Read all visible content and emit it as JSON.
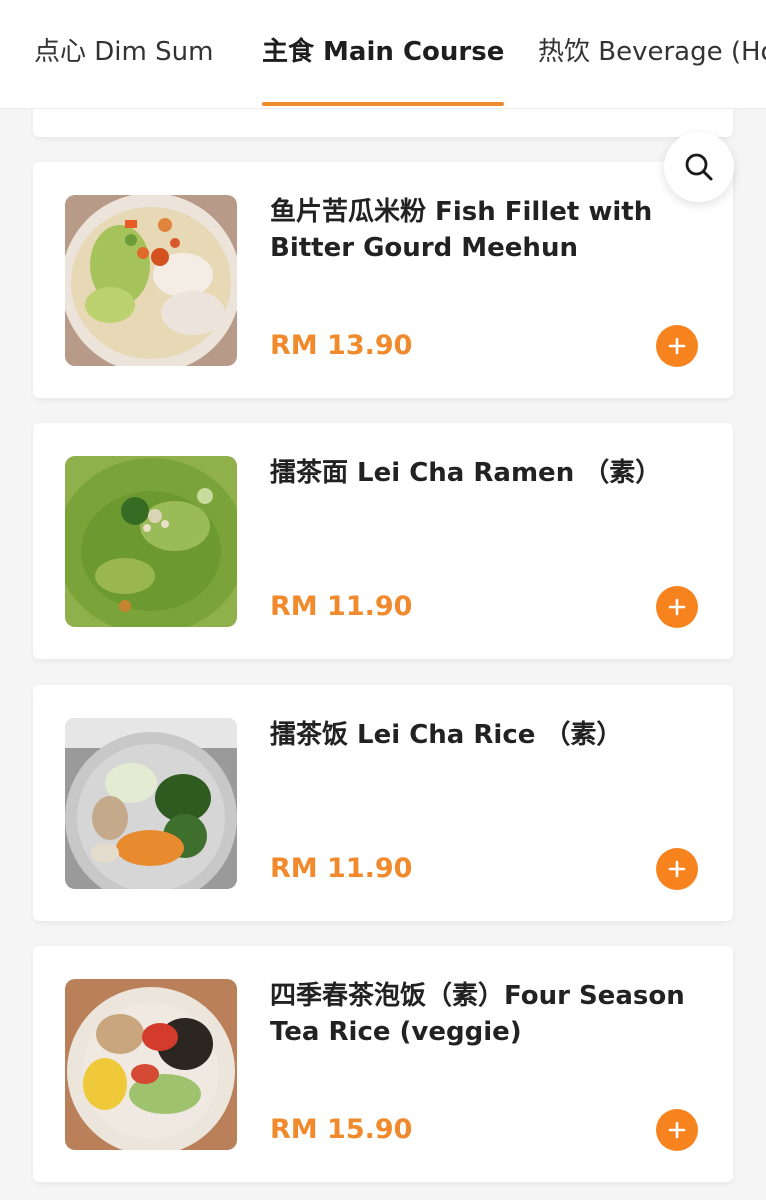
{
  "tabs": [
    {
      "label": "点心 Dim Sum",
      "active": false
    },
    {
      "label": "主食 Main Course",
      "active": true
    },
    {
      "label": "热饮 Beverage (Ho",
      "active": false
    }
  ],
  "search": {
    "icon": "search-icon"
  },
  "accent_color": "#f7831f",
  "items": [
    {
      "name": "鱼片苦瓜米粉 Fish Fillet with Bitter Gourd Meehun",
      "price": "RM 13.90"
    },
    {
      "name": "擂茶面 Lei Cha Ramen （素）",
      "price": "RM 11.90"
    },
    {
      "name": "擂茶饭 Lei Cha Rice （素）",
      "price": "RM 11.90"
    },
    {
      "name": "四季春茶泡饭（素）Four Season Tea Rice (veggie)",
      "price": "RM 15.90"
    }
  ]
}
